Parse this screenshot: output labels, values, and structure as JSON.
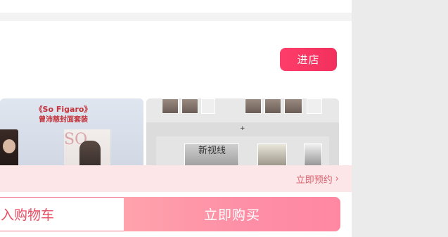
{
  "header": {
    "shop_button_label": "进店"
  },
  "products": {
    "left": {
      "title": "《So Figaro》",
      "subtitle": "曾沛慈封面套装",
      "cover_letters": "SO"
    },
    "right": {
      "book_title": "新视线"
    }
  },
  "reserve": {
    "label": "立即预约",
    "chevron": "›"
  },
  "actions": {
    "cart_label": "入购物车",
    "buy_label": "立即购买"
  },
  "colors": {
    "brand": "#f2305d",
    "reserve_bg": "#fde6e8",
    "reserve_text": "#d8616e",
    "buy_gradient_start": "#ffa3ad",
    "buy_gradient_end": "#ff87a2",
    "right_gray": "#ebebeb"
  },
  "icons": {
    "reserve_chevron": "chevron-right-icon"
  }
}
